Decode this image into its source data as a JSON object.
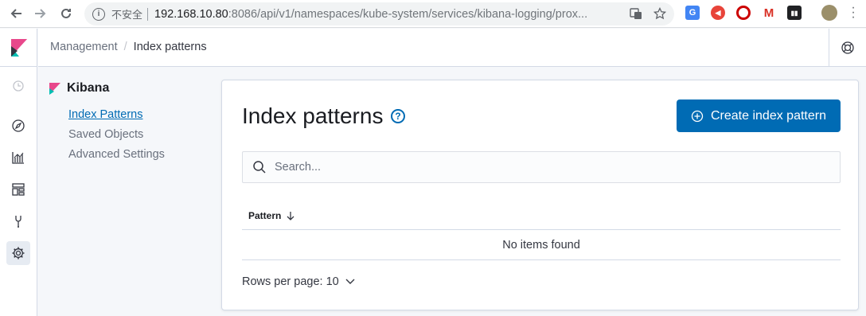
{
  "browser": {
    "insecure_label": "不安全",
    "url_host": "192.168.10.80",
    "url_path": ":8086/api/v1/namespaces/kube-system/services/kibana-logging/prox...",
    "ext_colors": [
      "#4285f4",
      "#e8443a",
      "#cc0000",
      "#d93025",
      "#202124"
    ]
  },
  "breadcrumb": {
    "parent": "Management",
    "separator": "/",
    "current": "Index patterns"
  },
  "sidebar": {
    "title": "Kibana",
    "items": [
      {
        "label": "Index Patterns",
        "selected": true
      },
      {
        "label": "Saved Objects",
        "selected": false
      },
      {
        "label": "Advanced Settings",
        "selected": false
      }
    ]
  },
  "nav_icons": [
    "clock-icon",
    "compass-icon",
    "visualize-icon",
    "dashboard-icon",
    "devtools-icon",
    "gear-icon"
  ],
  "main": {
    "title": "Index patterns",
    "help_glyph": "?",
    "create_button": "Create index pattern",
    "search_placeholder": "Search...",
    "column_header": "Pattern",
    "empty_message": "No items found",
    "rows_per_page": "Rows per page: 10"
  },
  "colors": {
    "primary": "#006bb4",
    "kibana_pink": "#e8488b",
    "kibana_teal": "#00bfb3"
  }
}
